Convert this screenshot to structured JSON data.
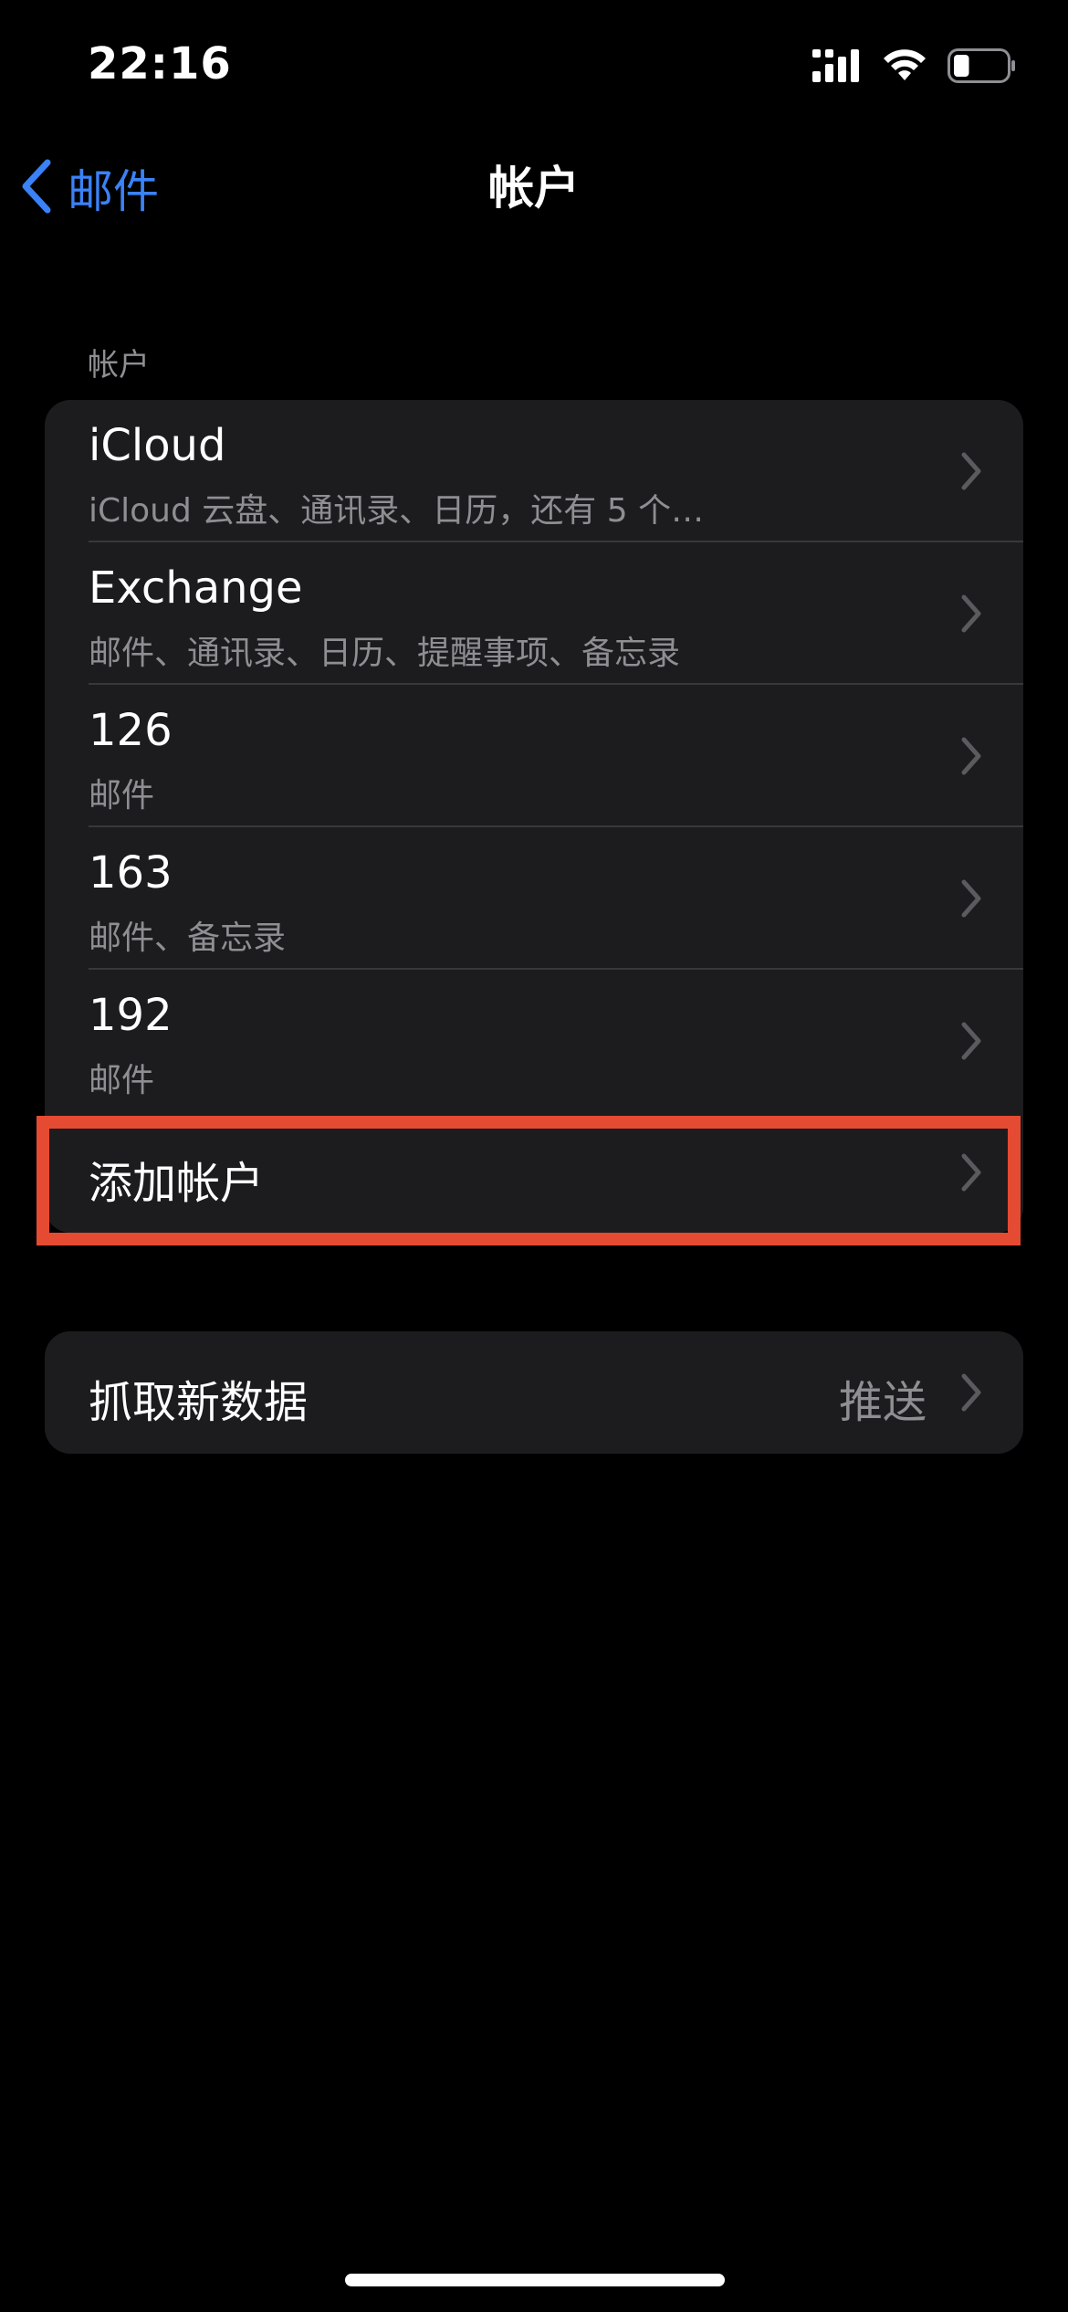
{
  "status_bar": {
    "time": "22:16",
    "icons": [
      "cellular-signal-icon",
      "wifi-icon",
      "battery-icon"
    ],
    "battery_level": 0.3
  },
  "nav": {
    "back_label": "邮件",
    "title": "帐户"
  },
  "accounts_section": {
    "header": "帐户",
    "items": [
      {
        "title": "iCloud",
        "subtitle": "iCloud 云盘、通讯录、日历，还有 5 个…"
      },
      {
        "title": "Exchange",
        "subtitle": "邮件、通讯录、日历、提醒事项、备忘录"
      },
      {
        "title": "126",
        "subtitle": "邮件"
      },
      {
        "title": "163",
        "subtitle": "邮件、备忘录"
      },
      {
        "title": "192",
        "subtitle": "邮件"
      }
    ],
    "add_account_label": "添加帐户"
  },
  "fetch_section": {
    "label": "抓取新数据",
    "value": "推送"
  },
  "colors": {
    "background": "#000000",
    "group_background": "#1c1c1e",
    "accent": "#3a82f7",
    "secondary_text": "#8e8e93",
    "highlight": "#e54a32"
  }
}
